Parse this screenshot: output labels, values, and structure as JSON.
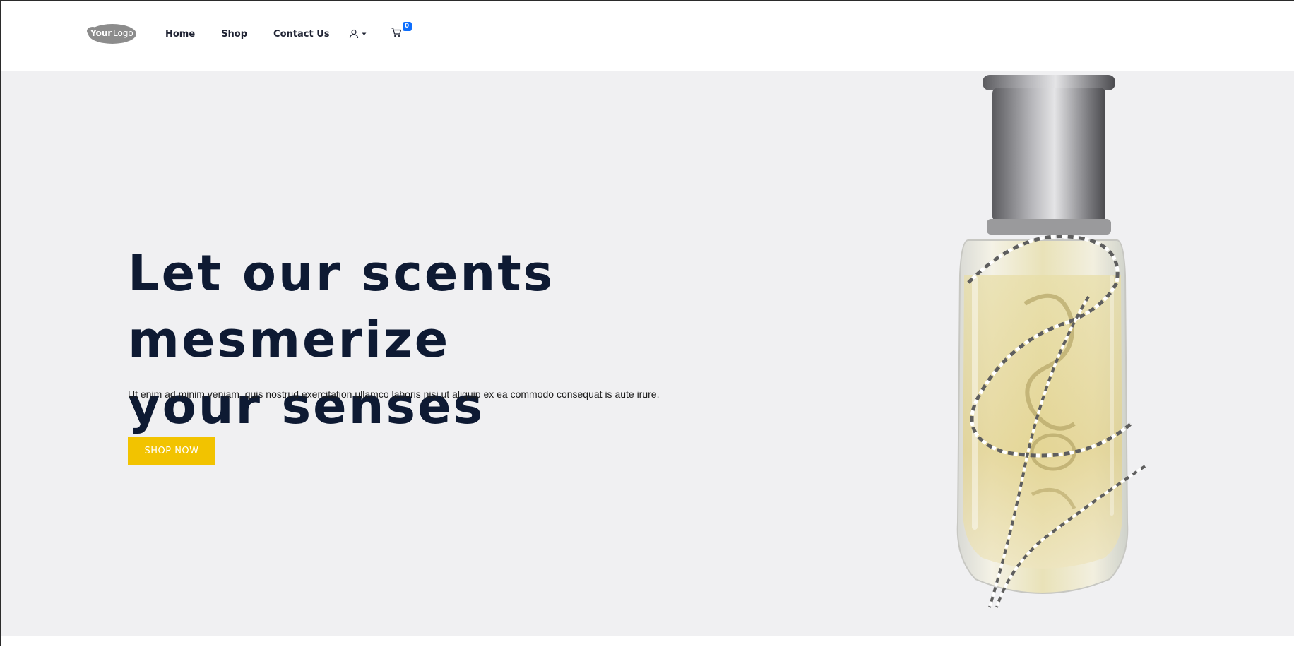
{
  "header": {
    "logo_text_bold": "Your",
    "logo_text_light": "Logo",
    "nav": {
      "home": "Home",
      "shop": "Shop",
      "contact": "Contact Us"
    },
    "user_icon": "user-icon",
    "cart_icon": "cart-icon",
    "cart_count": "0"
  },
  "hero": {
    "title_line1": "Let our scents mesmerize",
    "title_line2": "your senses",
    "subtitle": "Ut enim ad minim veniam, quis nostrud exercitation ullamco laboris nisi ut aliquip ex ea commodo consequat is aute irure.",
    "cta_label": "SHOP NOW"
  },
  "colors": {
    "accent": "#f2c300",
    "title": "#0e1a33",
    "hero_bg": "#f0f0f2",
    "badge": "#0d6efd"
  }
}
